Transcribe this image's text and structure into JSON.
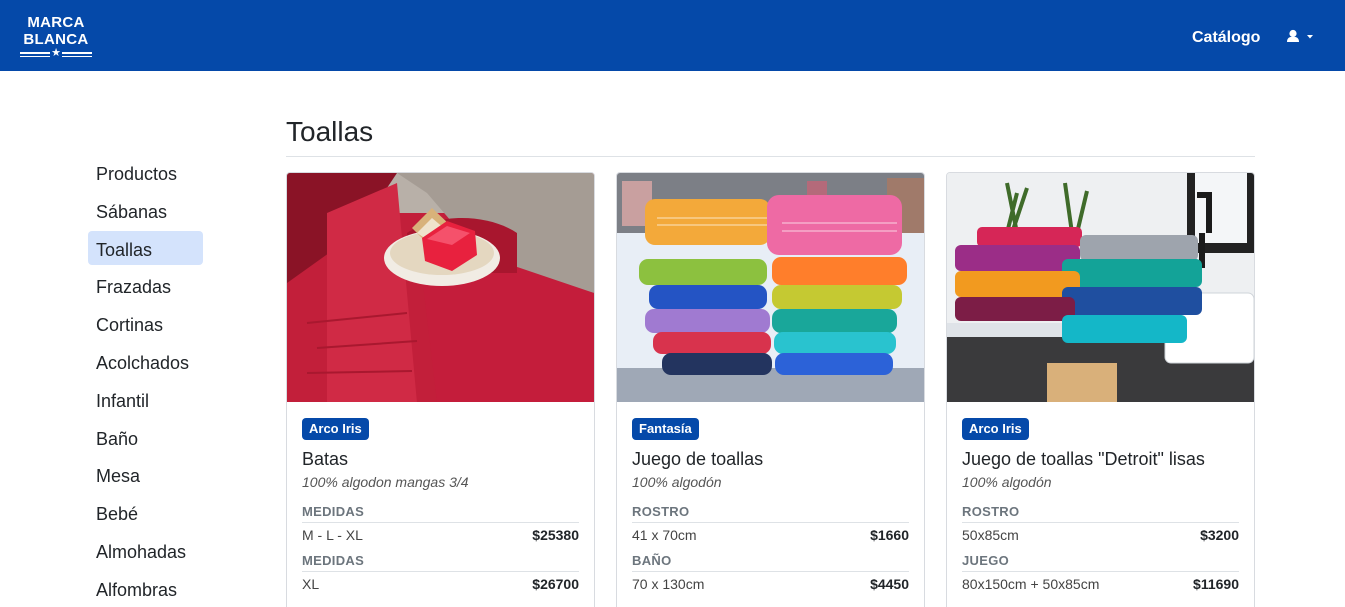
{
  "navbar": {
    "logo_line1": "MARCA",
    "logo_line2": "BLANCA",
    "catalog_link": "Catálogo",
    "user_icon": "user-icon",
    "brand_color": "#0549a9"
  },
  "sidebar": {
    "items": [
      {
        "label": "Productos"
      },
      {
        "label": "Sábanas"
      },
      {
        "label": "Toallas"
      },
      {
        "label": "Frazadas"
      },
      {
        "label": "Cortinas"
      },
      {
        "label": "Acolchados"
      },
      {
        "label": "Infantil"
      },
      {
        "label": "Baño"
      },
      {
        "label": "Mesa"
      },
      {
        "label": "Bebé"
      },
      {
        "label": "Almohadas"
      },
      {
        "label": "Alfombras"
      }
    ],
    "active": "Toallas",
    "active_color": "#d4e3fc"
  },
  "main": {
    "title": "Toallas",
    "cards": [
      {
        "badge": "Arco Iris",
        "title": "Batas",
        "subtitle": "100% algodon mangas 3/4",
        "groups": [
          {
            "label": "MEDIDAS",
            "size": "M - L - XL",
            "price": "$25380"
          },
          {
            "label": "MEDIDAS",
            "size": "XL",
            "price": "$26700"
          }
        ]
      },
      {
        "badge": "Fantasía",
        "title": "Juego de toallas",
        "subtitle": "100% algodón",
        "groups": [
          {
            "label": "ROSTRO",
            "size": "41 x 70cm",
            "price": "$1660"
          },
          {
            "label": "BAÑO",
            "size": "70 x 130cm",
            "price": "$4450"
          }
        ]
      },
      {
        "badge": "Arco Iris",
        "title": "Juego de toallas \"Detroit\" lisas",
        "subtitle": "100% algodón",
        "groups": [
          {
            "label": "ROSTRO",
            "size": "50x85cm",
            "price": "$3200"
          },
          {
            "label": "JUEGO",
            "size": "80x150cm + 50x85cm",
            "price": "$11690"
          }
        ]
      }
    ]
  }
}
